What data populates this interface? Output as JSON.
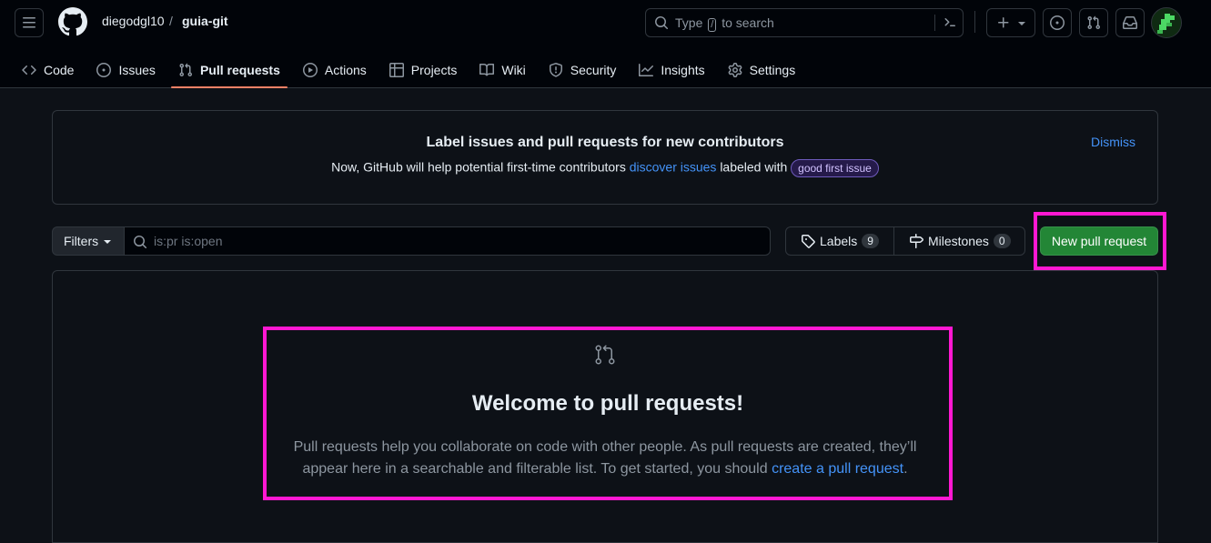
{
  "header": {
    "owner": "diegodgl10",
    "separator": "/",
    "repo": "guia-git",
    "search": {
      "prefix": "Type",
      "key": "/",
      "suffix": "to search"
    },
    "icons": [
      "menu-icon",
      "github-logo-icon",
      "search-icon",
      "command-palette-icon",
      "plus-icon",
      "issue-icon",
      "pull-request-icon",
      "inbox-icon"
    ]
  },
  "tabs": [
    {
      "label": "Code",
      "icon": "code-icon"
    },
    {
      "label": "Issues",
      "icon": "issue-icon"
    },
    {
      "label": "Pull requests",
      "icon": "pull-request-icon",
      "active": true
    },
    {
      "label": "Actions",
      "icon": "play-icon"
    },
    {
      "label": "Projects",
      "icon": "table-icon"
    },
    {
      "label": "Wiki",
      "icon": "book-icon"
    },
    {
      "label": "Security",
      "icon": "shield-icon"
    },
    {
      "label": "Insights",
      "icon": "graph-icon"
    },
    {
      "label": "Settings",
      "icon": "gear-icon"
    }
  ],
  "banner": {
    "title": "Label issues and pull requests for new contributors",
    "text_before": "Now, GitHub will help potential first-time contributors",
    "link": "discover issues",
    "text_after": "labeled with",
    "label": "good first issue",
    "dismiss": "Dismiss"
  },
  "toolbar": {
    "filters": "Filters",
    "search_placeholder": "is:pr is:open",
    "labels": "Labels",
    "labels_count": "9",
    "milestones": "Milestones",
    "milestones_count": "0",
    "new_pr": "New pull request"
  },
  "blankslate": {
    "title": "Welcome to pull requests!",
    "text": "Pull requests help you collaborate on code with other people. As pull requests are created, they’ll appear here in a searchable and filterable list. To get started, you should",
    "link": "create a pull request",
    "end": "."
  },
  "colors": {
    "background": "#0d1117",
    "header": "#010409",
    "accent_link": "#4493f8",
    "primary_button": "#238636",
    "active_tab_underline": "#f78166",
    "highlight_box": "#ff18d2"
  }
}
